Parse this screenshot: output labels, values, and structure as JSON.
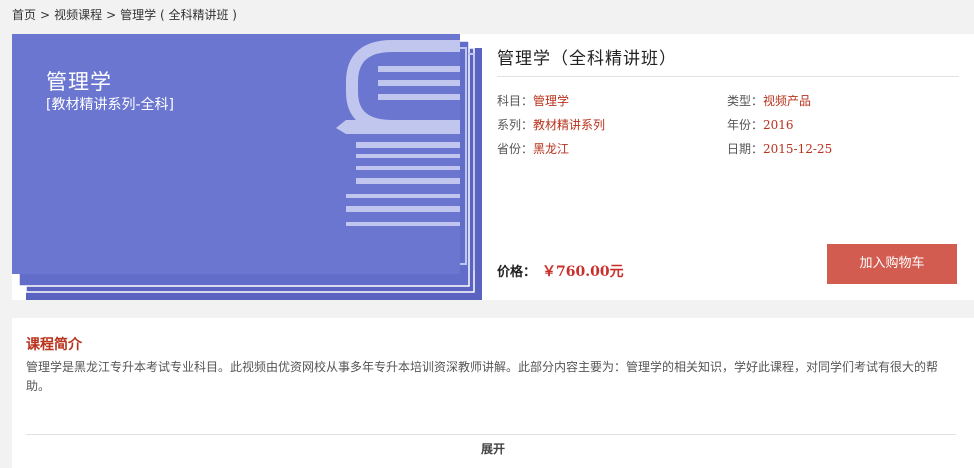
{
  "breadcrumb": {
    "home": "首页",
    "video_courses": "视频课程",
    "current": "管理学 ( 全科精讲班 )",
    "separator": ">"
  },
  "cover": {
    "title": "管理学",
    "subtitle": "[教材精讲系列-全科]",
    "colors": {
      "main": "#6b76d0",
      "shadow": "#5a64c0",
      "art": "#c1c6ee"
    }
  },
  "product": {
    "title": "管理学（全科精讲班）",
    "attributes": {
      "subject_label": "科目：",
      "subject": "管理学",
      "type_label": "类型：",
      "type": "视频产品",
      "series_label": "系列：",
      "series": "教材精讲系列",
      "year_label": "年份：",
      "year": "2016",
      "province_label": "省份：",
      "province": "黑龙江",
      "date_label": "日期：",
      "date": "2015-12-25"
    },
    "price_label": "价格：",
    "price": "￥760.00元",
    "cart_button": "加入购物车"
  },
  "intro": {
    "title": "课程简介",
    "text": "管理学是黑龙江专升本考试专业科目。此视频由优资网校从事多年专升本培训资深教师讲解。此部分内容主要为：管理学的相关知识，学好此课程，对同学们考试有很大的帮助。",
    "expand": "展开"
  },
  "colors": {
    "accent": "#b8321c",
    "price": "#c9302c",
    "button": "#d15c4f"
  }
}
